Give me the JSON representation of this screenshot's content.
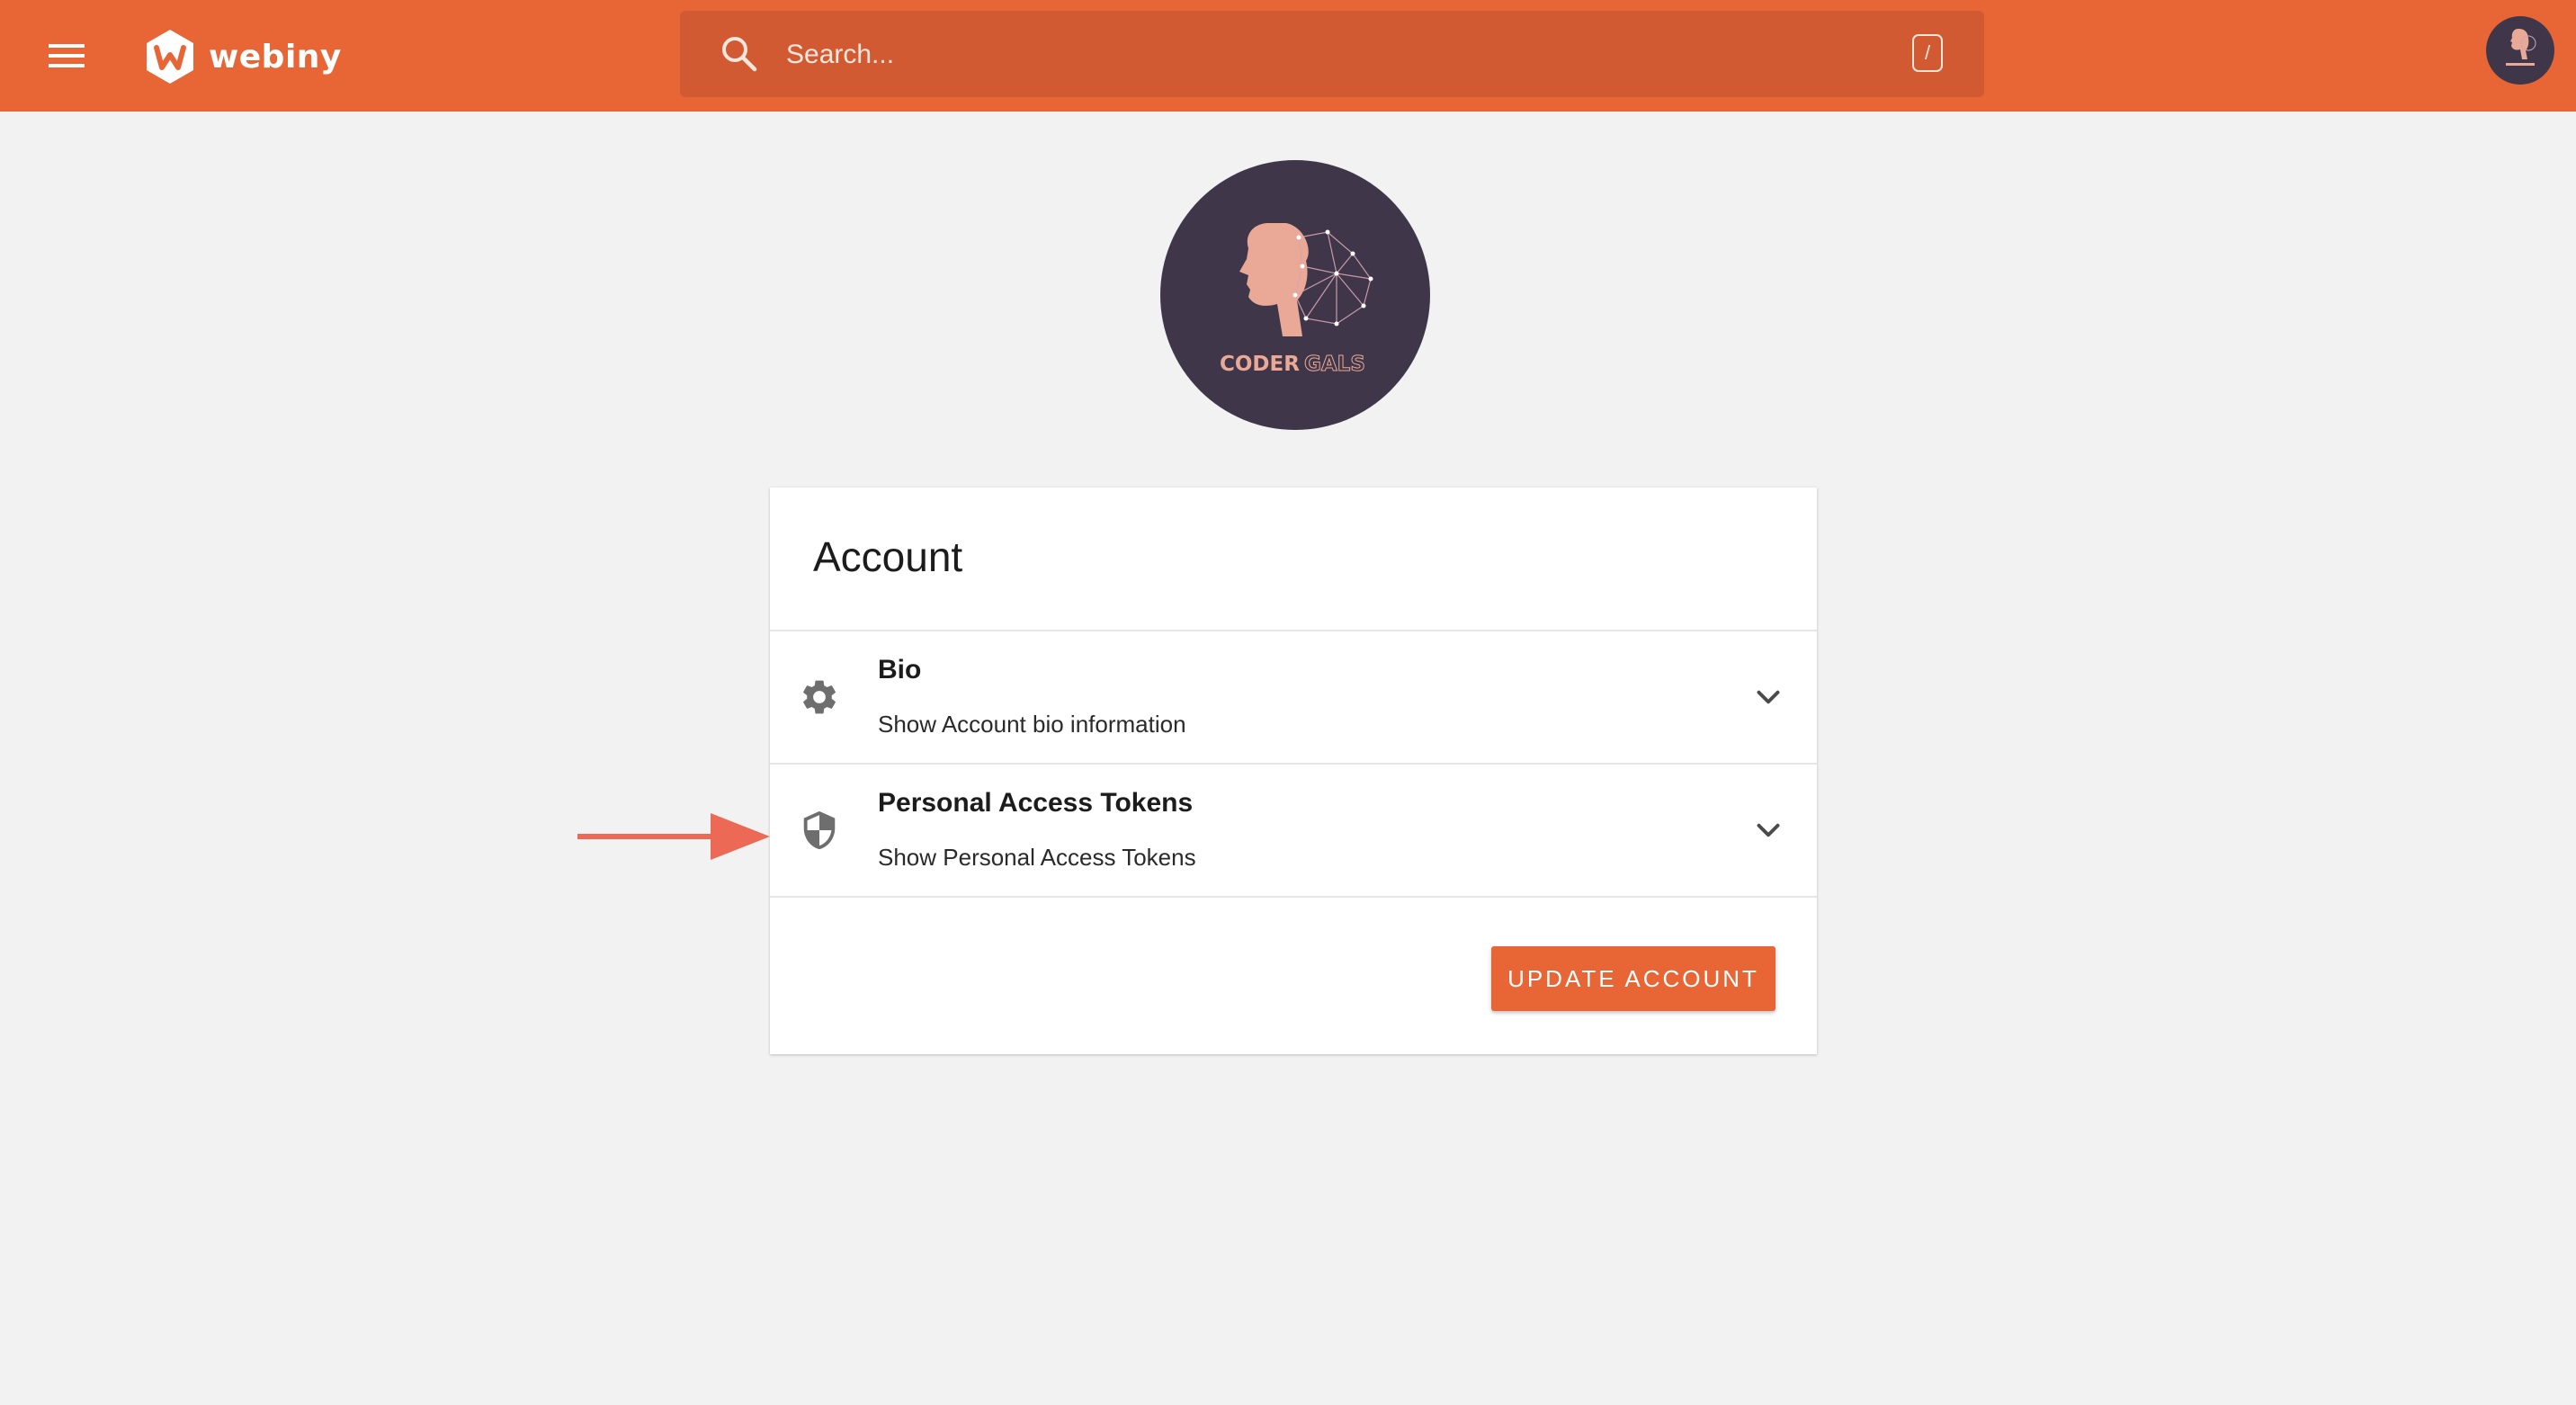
{
  "colors": {
    "brand": "#e86636",
    "search_bg": "#d25a33",
    "avatar_bg": "#3f3749",
    "avatar_accent": "#e9a996",
    "page_bg": "#f2f2f2",
    "annotation_arrow": "#ec6a55"
  },
  "header": {
    "menu_icon": "hamburger-icon",
    "logo_text": "webiny",
    "search": {
      "icon": "search-icon",
      "placeholder": "Search...",
      "shortcut": "/"
    },
    "avatar_icon": "user-avatar"
  },
  "profile": {
    "avatar_text_primary": "CODER",
    "avatar_text_secondary": "GALS"
  },
  "account": {
    "title": "Account",
    "sections": [
      {
        "icon": "gear-icon",
        "title": "Bio",
        "subtitle": "Show Account bio information",
        "expand_icon": "chevron-down-icon"
      },
      {
        "icon": "shield-icon",
        "title": "Personal Access Tokens",
        "subtitle": "Show Personal Access Tokens",
        "expand_icon": "chevron-down-icon"
      }
    ],
    "update_label": "UPDATE ACCOUNT"
  },
  "annotation": {
    "icon": "arrow-right-icon"
  }
}
